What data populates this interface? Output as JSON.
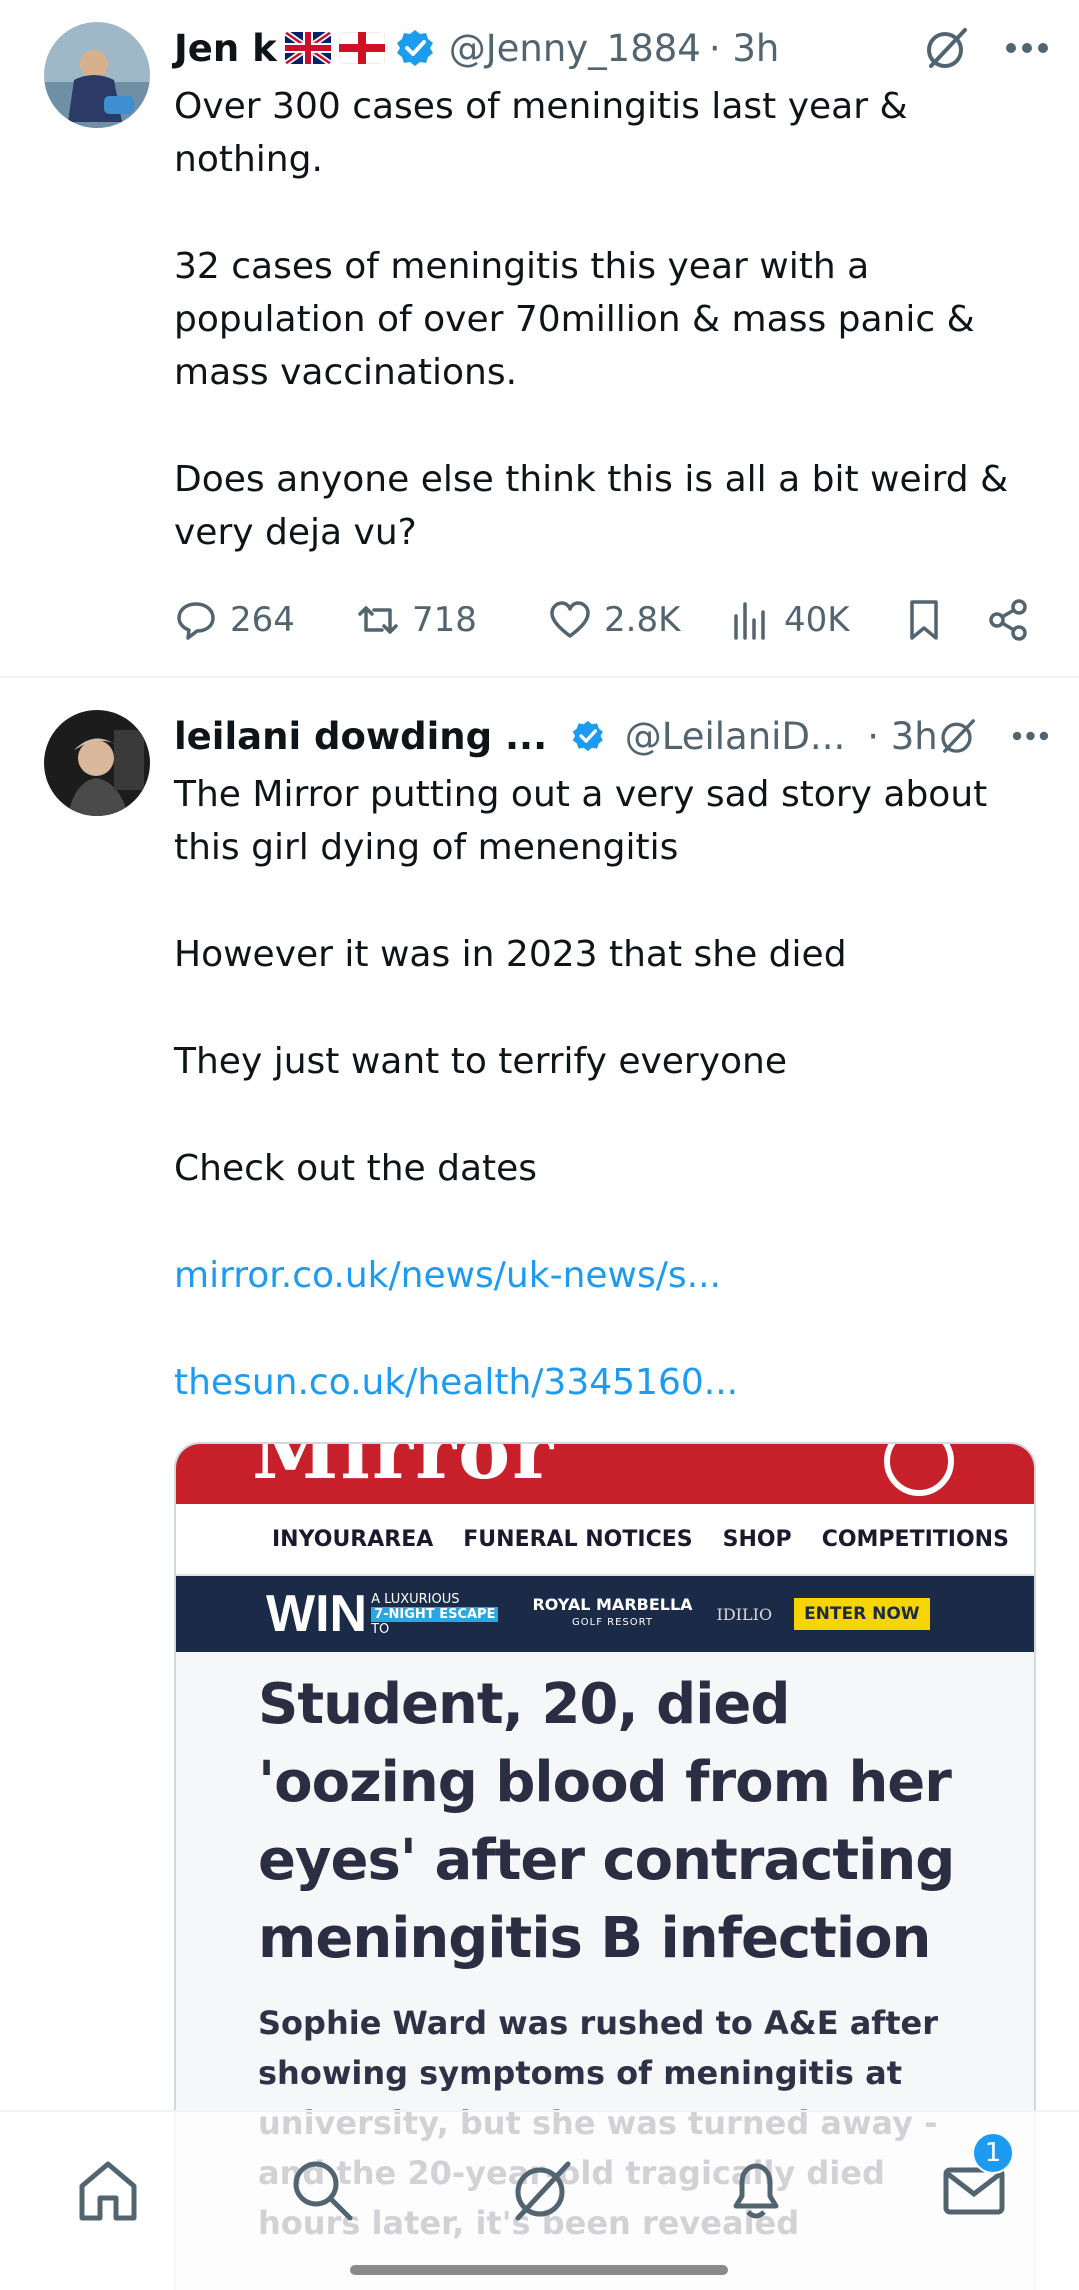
{
  "tweets": [
    {
      "name": "Jen k",
      "handle": "@Jenny_1884",
      "time": "· 3h",
      "paragraphs": [
        "Over 300 cases of meningitis last year & nothing.",
        "32 cases of meningitis this year with a population of over 70million & mass panic & mass vaccinations.",
        "Does anyone else think this is all a bit weird & very deja vu?"
      ],
      "stats": {
        "replies": "264",
        "reposts": "718",
        "likes": "2.8K",
        "views": "40K"
      }
    },
    {
      "name": "leilani dowding ...",
      "handle": "@LeilaniD...",
      "time": "· 3h",
      "paragraphs": [
        "The Mirror putting out a very sad story about this girl dying of menengitis",
        "However it was in 2023 that she died",
        "They just want to terrify everyone",
        "Check out the dates"
      ],
      "links": [
        "mirror.co.uk/news/uk-news/s...",
        "thesun.co.uk/health/3345160..."
      ],
      "card": {
        "logo": "Mirror",
        "nav": [
          "INYOURAREA",
          "FUNERAL NOTICES",
          "SHOP",
          "COMPETITIONS"
        ],
        "ad": {
          "win": "WIN",
          "lux_line1": "A LUXURIOUS",
          "lux_line2": "7-NIGHT ESCAPE",
          "lux_line3": "TO",
          "royal": "ROYAL MARBELLA",
          "royal_sub": "GOLF RESORT",
          "idilio": "IDILIO",
          "cta": "ENTER NOW"
        },
        "headline": "Student, 20, died 'oozing blood from her eyes' after contracting meningitis B infection",
        "subheadline": "Sophie Ward was rushed to A&E after showing symptoms of meningitis at university, but she was turned away - and the 20-year-old tragically died hours later, it's been revealed"
      }
    }
  ],
  "bottom_nav": {
    "items": [
      "home-icon",
      "search-icon",
      "grok-icon",
      "notifications-icon",
      "messages-icon"
    ],
    "messages_badge": "1"
  },
  "colors": {
    "accent": "#1d9bf0",
    "text": "#0f1419",
    "secondary": "#536471",
    "mirror_red": "#c8202a"
  }
}
